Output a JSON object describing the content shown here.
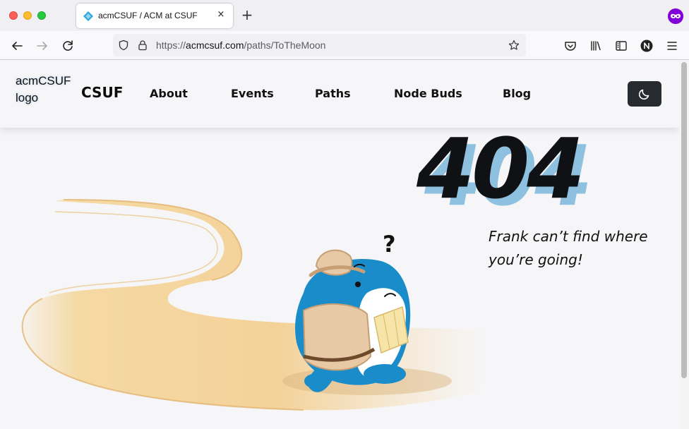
{
  "browser": {
    "tab_title": "acmCSUF / ACM at CSUF",
    "tab_close": "×",
    "new_tab": "+",
    "url_scheme": "https://",
    "url_host": "acmcsuf.com",
    "url_path": "/paths/ToTheMoon",
    "private_badge": "private-browsing-icon"
  },
  "header": {
    "logo_alt": "acmCSUF logo",
    "brand": "CSUF",
    "nav": [
      "About",
      "Events",
      "Paths",
      "Node Buds",
      "Blog"
    ],
    "theme_toggle_icon": "moon-icon"
  },
  "error": {
    "code": "404",
    "message": "Frank can’t find where you’re going!"
  },
  "colors": {
    "error_shadow": "#8ec1df",
    "theme_button": "#272a2f",
    "path_sand": "#f5d9a3",
    "shark_blue": "#1a8cc9"
  }
}
